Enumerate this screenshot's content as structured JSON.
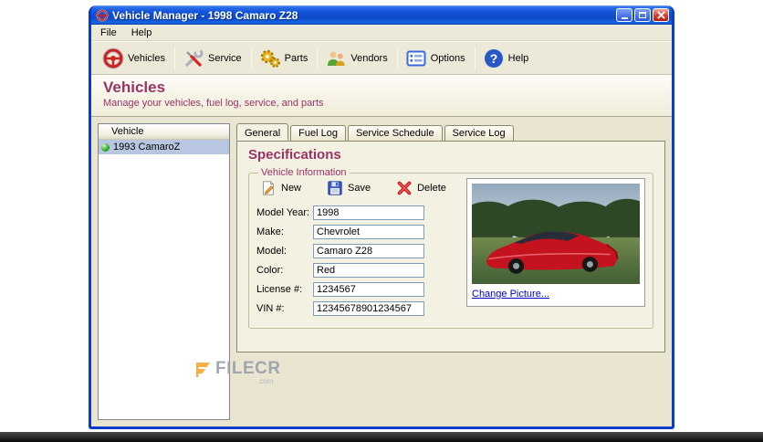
{
  "titlebar": {
    "title": "Vehicle Manager - 1998 Camaro Z28"
  },
  "menu": {
    "items": [
      {
        "label": "File"
      },
      {
        "label": "Help"
      }
    ]
  },
  "toolbar": {
    "items": [
      {
        "label": "Vehicles",
        "icon": "steering-wheel-icon"
      },
      {
        "label": "Service",
        "icon": "tools-icon"
      },
      {
        "label": "Parts",
        "icon": "gears-icon"
      },
      {
        "label": "Vendors",
        "icon": "people-icon"
      },
      {
        "label": "Options",
        "icon": "list-options-icon"
      },
      {
        "label": "Help",
        "icon": "question-icon"
      }
    ]
  },
  "header": {
    "title": "Vehicles",
    "subtitle": "Manage your vehicles, fuel log, service, and parts"
  },
  "vehicle_list": {
    "header": "Vehicle",
    "items": [
      {
        "label": "1993 CamaroZ",
        "status_icon": "green-ball"
      }
    ]
  },
  "tabs": {
    "items": [
      {
        "label": "General"
      },
      {
        "label": "Fuel Log"
      },
      {
        "label": "Service Schedule"
      },
      {
        "label": "Service Log"
      }
    ],
    "active": "General"
  },
  "specifications": {
    "title": "Specifications",
    "group_title": "Vehicle Information",
    "buttons": [
      {
        "label": "New",
        "icon": "new-document-icon"
      },
      {
        "label": "Save",
        "icon": "floppy-disk-icon"
      },
      {
        "label": "Delete",
        "icon": "red-x-icon"
      }
    ],
    "fields": [
      {
        "label": "Model Year:",
        "value": "1998"
      },
      {
        "label": "Make:",
        "value": "Chevrolet"
      },
      {
        "label": "Model:",
        "value": "Camaro Z28"
      },
      {
        "label": "Color:",
        "value": "Red"
      },
      {
        "label": "License #:",
        "value": "1234567"
      },
      {
        "label": "VIN #:",
        "value": "12345678901234567"
      }
    ],
    "change_picture_link": "Change Picture..."
  },
  "watermark": {
    "name": "FILECR",
    "tld": ".com"
  },
  "icons": {
    "help_glyph": "?"
  },
  "colors": {
    "accent": "#993366",
    "titlebar_blue": "#1354d8",
    "selection": "#b9c6e2",
    "link": "#0000cc"
  }
}
